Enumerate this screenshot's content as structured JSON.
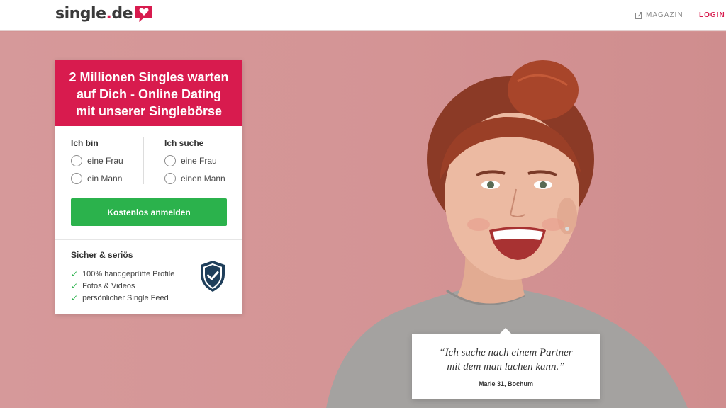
{
  "header": {
    "logo": {
      "main": "single",
      "dot": ".",
      "tld": "de"
    },
    "nav": {
      "magazin": "MAGAZIN",
      "login": "LOGIN"
    }
  },
  "signup": {
    "headline": [
      "2 Millionen Singles warten",
      "auf Dich - Online Dating",
      "mit unserer Singlebörse"
    ],
    "i_am": {
      "title": "Ich bin",
      "options": [
        "eine Frau",
        "ein Mann"
      ]
    },
    "looking_for": {
      "title": "Ich suche",
      "options": [
        "eine Frau",
        "einen Mann"
      ]
    },
    "cta": "Kostenlos anmelden",
    "safety": {
      "title": "Sicher & seriös",
      "items": [
        "100% handgeprüfte Profile",
        "Fotos & Videos",
        "persönlicher Single Feed"
      ]
    }
  },
  "testimonial": {
    "quote": [
      "“Ich suche nach einem Partner",
      "mit dem man lachen kann.”"
    ],
    "author": "Marie 31, Bochum"
  },
  "icons": {
    "logo": "heart-speech-bubble-icon",
    "magazin": "external-link-icon",
    "check": "checkmark-icon",
    "shield": "shield-check-icon"
  },
  "colors": {
    "brand": "#d81b4e",
    "cta": "#2bb24c",
    "hero_bg": "#d49494",
    "shield": "#1f3f5b"
  }
}
